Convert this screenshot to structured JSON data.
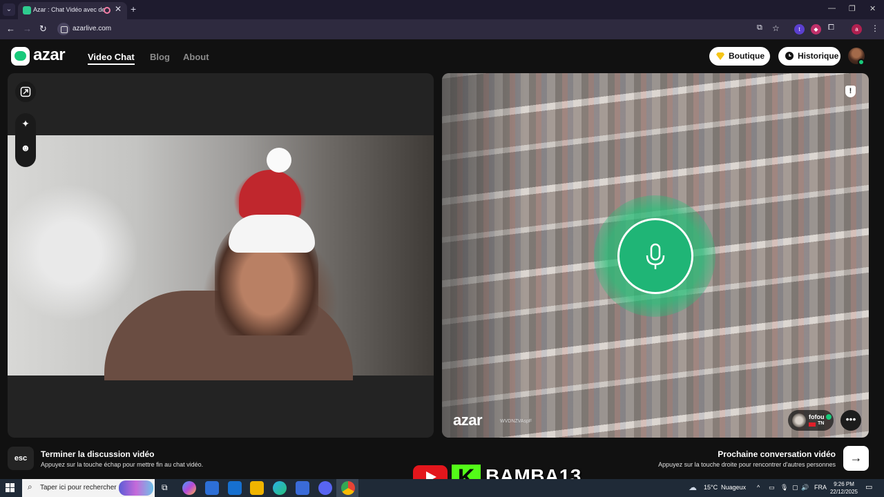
{
  "browser": {
    "tab_title": "Azar : Chat Vidéo avec de n",
    "url": "azarlive.com",
    "ext_t": "t",
    "ext_profile": "a"
  },
  "site": {
    "logo_text": "azar",
    "nav": [
      "Video Chat",
      "Blog",
      "About"
    ],
    "shop_label": "Boutique",
    "history_label": "Historique"
  },
  "remote": {
    "watermark": "azar",
    "session_id": "WVDNZVAspF",
    "peer_name": "fofou",
    "peer_country": "TN"
  },
  "footer": {
    "esc_key": "esc",
    "end_title": "Terminer la discussion vidéo",
    "end_hint": "Appuyez sur la touche échap pour mettre fin au chat vidéo.",
    "next_title": "Prochaine conversation vidéo",
    "next_hint": "Appuyez sur la touche droite pour rencontrer d'autres personnes"
  },
  "overlay": {
    "handle": "BAMBA13",
    "kick_letter": "K"
  },
  "taskbar": {
    "search_placeholder": "Taper ici pour rechercher",
    "weather_temp": "15°C",
    "weather_text": "Nuageux",
    "lang": "FRA",
    "time": "9:26 PM",
    "date": "22/12/2025"
  },
  "colors": {
    "brand_green": "#18c97a",
    "mic_green": "#1fb576",
    "youtube_red": "#e3161c",
    "kick_green": "#53fc18"
  }
}
